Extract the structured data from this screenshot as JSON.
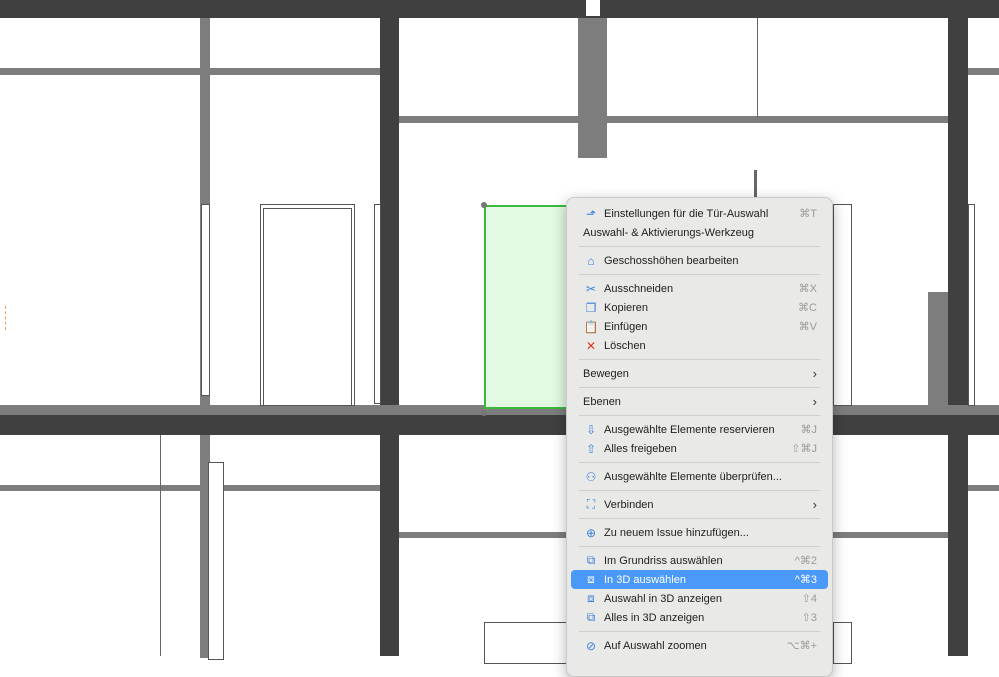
{
  "menu": {
    "items": [
      {
        "icon": "door-settings-icon",
        "label": "Einstellungen für die Tür-Auswahl",
        "shortcut": "⌘T"
      },
      {
        "label": "Auswahl- & Aktivierungs-Werkzeug"
      },
      {
        "icon": "story-levels-icon",
        "label": "Geschosshöhen bearbeiten"
      },
      {
        "icon": "scissors-icon",
        "label": "Ausschneiden",
        "shortcut": "⌘X"
      },
      {
        "icon": "copy-icon",
        "label": "Kopieren",
        "shortcut": "⌘C"
      },
      {
        "icon": "paste-icon",
        "label": "Einfügen",
        "shortcut": "⌘V"
      },
      {
        "icon": "delete-icon",
        "label": "Löschen"
      },
      {
        "label": "Bewegen",
        "submenu": "›"
      },
      {
        "label": "Ebenen",
        "submenu": "›"
      },
      {
        "icon": "reserve-icon",
        "label": "Ausgewählte Elemente reservieren",
        "shortcut": "⌘J"
      },
      {
        "icon": "release-icon",
        "label": "Alles freigeben",
        "shortcut": "⇧⌘J"
      },
      {
        "icon": "check-elements-icon",
        "label": "Ausgewählte Elemente überprüfen..."
      },
      {
        "icon": "connect-icon",
        "label": "Verbinden",
        "submenu": "›"
      },
      {
        "icon": "issue-add-icon",
        "label": "Zu neuem Issue hinzufügen..."
      },
      {
        "icon": "floorplan-select-icon",
        "label": "Im Grundriss auswählen",
        "shortcut": "^⌘2"
      },
      {
        "icon": "select-3d-icon",
        "label": "In 3D auswählen",
        "shortcut": "^⌘3"
      },
      {
        "icon": "show-selection-3d-icon",
        "label": "Auswahl in 3D anzeigen",
        "shortcut": "⇧4"
      },
      {
        "icon": "show-all-3d-icon",
        "label": "Alles in 3D anzeigen",
        "shortcut": "⇧3"
      },
      {
        "icon": "zoom-selection-icon",
        "label": "Auf Auswahl zoomen",
        "shortcut": "⌥⌘+"
      }
    ]
  },
  "colors": {
    "highlight": "#4b99f7",
    "selection_fill": "#e2f9e2",
    "selection_stroke": "#3cb83c",
    "delete": "#e8321e"
  }
}
